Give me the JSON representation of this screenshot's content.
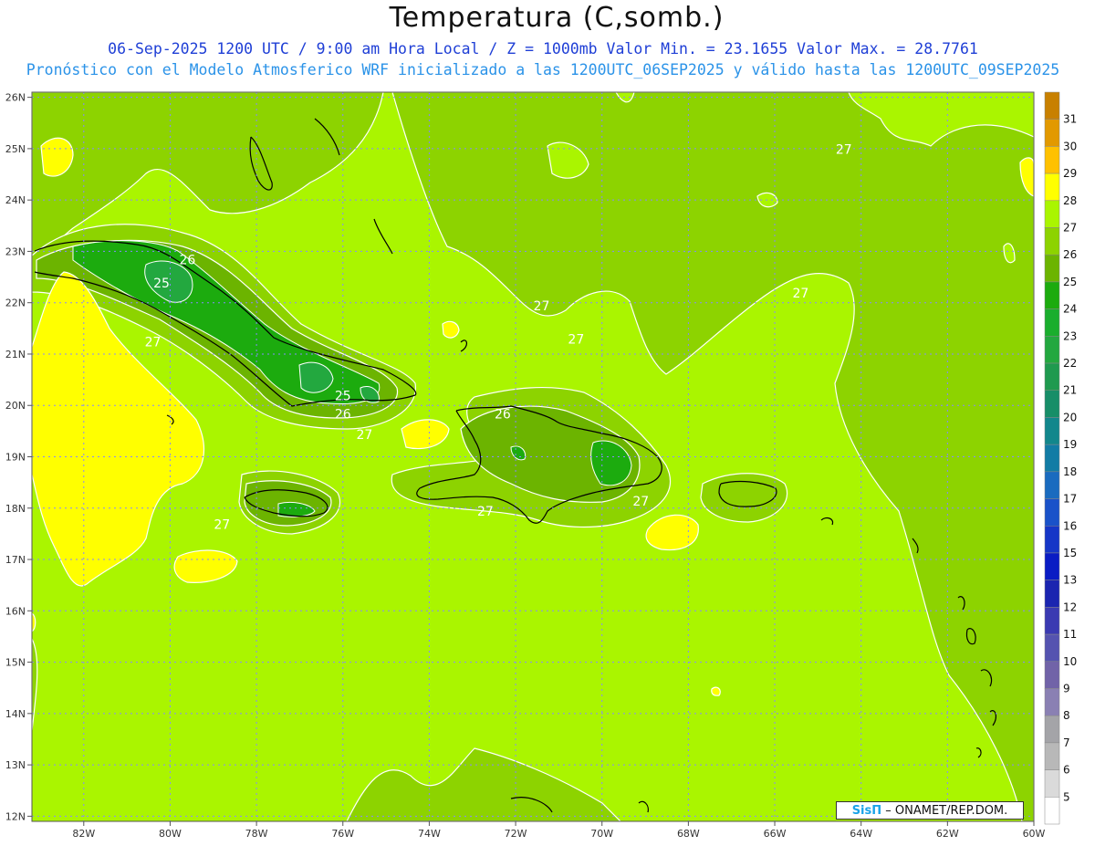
{
  "title": "Temperatura (C,somb.)",
  "subtitle_line1": "06-Sep-2025 1200 UTC / 9:00 am Hora Local / Z = 1000mb   Valor Min. = 23.1655  Valor Max. = 28.7761",
  "subtitle_line2": "Pronóstico con el Modelo Atmosferico WRF inicializado a las 1200UTC_06SEP2025 y válido hasta las  1200UTC_09SEP2025",
  "credit": {
    "logo": "SisΠ",
    "text": "– ONAMET/REP.DOM."
  },
  "map": {
    "lon_range": [
      -83.2,
      -60.0
    ],
    "lat_range": [
      11.9,
      26.1
    ],
    "lon_ticks": [
      {
        "value": -82,
        "label": "82W"
      },
      {
        "value": -80,
        "label": "80W"
      },
      {
        "value": -78,
        "label": "78W"
      },
      {
        "value": -76,
        "label": "76W"
      },
      {
        "value": -74,
        "label": "74W"
      },
      {
        "value": -72,
        "label": "72W"
      },
      {
        "value": -70,
        "label": "70W"
      },
      {
        "value": -68,
        "label": "68W"
      },
      {
        "value": -66,
        "label": "66W"
      },
      {
        "value": -64,
        "label": "64W"
      },
      {
        "value": -62,
        "label": "62W"
      },
      {
        "value": -60,
        "label": "60W"
      }
    ],
    "lat_ticks": [
      {
        "value": 12,
        "label": "12N"
      },
      {
        "value": 13,
        "label": "13N"
      },
      {
        "value": 14,
        "label": "14N"
      },
      {
        "value": 15,
        "label": "15N"
      },
      {
        "value": 16,
        "label": "16N"
      },
      {
        "value": 17,
        "label": "17N"
      },
      {
        "value": 18,
        "label": "18N"
      },
      {
        "value": 19,
        "label": "19N"
      },
      {
        "value": 20,
        "label": "20N"
      },
      {
        "value": 21,
        "label": "21N"
      },
      {
        "value": 22,
        "label": "22N"
      },
      {
        "value": 23,
        "label": "23N"
      },
      {
        "value": 24,
        "label": "24N"
      },
      {
        "value": 25,
        "label": "25N"
      },
      {
        "value": 26,
        "label": "26N"
      }
    ],
    "grid_on": true,
    "background_color": "#aaf500",
    "contour_labels": [
      {
        "text": "26",
        "lon": -79.6,
        "lat": 22.75
      },
      {
        "text": "25",
        "lon": -80.2,
        "lat": 22.3
      },
      {
        "text": "27",
        "lon": -80.4,
        "lat": 21.15
      },
      {
        "text": "25",
        "lon": -76.0,
        "lat": 20.1
      },
      {
        "text": "26",
        "lon": -76.0,
        "lat": 19.75
      },
      {
        "text": "27",
        "lon": -75.5,
        "lat": 19.35
      },
      {
        "text": "26",
        "lon": -72.3,
        "lat": 19.75
      },
      {
        "text": "27",
        "lon": -71.4,
        "lat": 21.85
      },
      {
        "text": "27",
        "lon": -70.6,
        "lat": 21.2
      },
      {
        "text": "27",
        "lon": -65.4,
        "lat": 22.1
      },
      {
        "text": "27",
        "lon": -64.4,
        "lat": 24.9
      },
      {
        "text": "27",
        "lon": -78.8,
        "lat": 17.6
      },
      {
        "text": "27",
        "lon": -72.7,
        "lat": 17.85
      },
      {
        "text": "27",
        "lon": -69.1,
        "lat": 18.05
      }
    ]
  },
  "colorbar": {
    "levels": [
      "31",
      "30",
      "29",
      "28",
      "27",
      "26",
      "25",
      "24",
      "23",
      "22",
      "21",
      "20",
      "19",
      "18",
      "17",
      "16",
      "15",
      "13",
      "12",
      "11",
      "10",
      "9",
      "8",
      "7",
      "6",
      "5"
    ],
    "colors": [
      "#c88000",
      "#e29900",
      "#ffc100",
      "#ffff00",
      "#aaf500",
      "#8dd300",
      "#6cb400",
      "#1cab0e",
      "#1aae2d",
      "#23a83f",
      "#1f9a4f",
      "#178e68",
      "#12878c",
      "#127ca5",
      "#1a6bbf",
      "#1a52c9",
      "#1636c7",
      "#0a1cc4",
      "#1b25b0",
      "#3b3ab2",
      "#5553b0",
      "#7163a8",
      "#8a80b3",
      "#a4a4a8",
      "#b8b8b8",
      "#dadada",
      "#ffffff"
    ]
  }
}
